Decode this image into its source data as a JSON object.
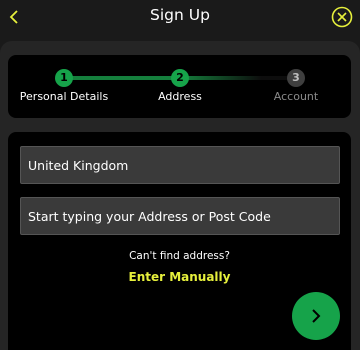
{
  "header": {
    "title": "Sign Up",
    "back_icon": "chevron-left-icon",
    "close_icon": "close-circle-icon",
    "accent": "#e6f03c"
  },
  "stepper": {
    "steps": [
      {
        "number": "1",
        "label": "Personal Details",
        "state": "done"
      },
      {
        "number": "2",
        "label": "Address",
        "state": "current"
      },
      {
        "number": "3",
        "label": "Account",
        "state": "todo"
      }
    ],
    "active_color": "#16a34a"
  },
  "form": {
    "country_value": "United Kingdom",
    "address_placeholder": "Start typing your Address or Post Code",
    "cant_find_text": "Can't find address?",
    "enter_manually_label": "Enter Manually"
  },
  "next_button": {
    "icon": "chevron-right-icon",
    "color": "#16a34a"
  }
}
